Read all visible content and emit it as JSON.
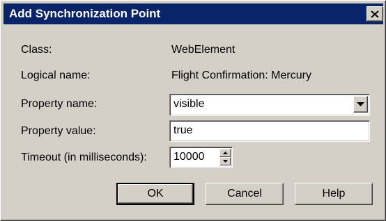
{
  "dialog": {
    "title": "Add Synchronization Point"
  },
  "icons": {
    "close": "close-icon",
    "dropdown": "chevron-down-icon",
    "spin_up": "arrow-up-icon",
    "spin_down": "arrow-down-icon"
  },
  "colors": {
    "titlebar": "#0a246a",
    "face": "#d4d0c8"
  },
  "fields": {
    "class_label": "Class:",
    "class_value": "WebElement",
    "logical_label": "Logical name:",
    "logical_value": "Flight Confirmation: Mercury",
    "property_name_label": "Property name:",
    "property_name_value": "visible",
    "property_value_label": "Property value:",
    "property_value_value": "true",
    "timeout_label": "Timeout (in milliseconds):",
    "timeout_value": "10000"
  },
  "buttons": {
    "ok": "OK",
    "cancel": "Cancel",
    "help": "Help"
  }
}
